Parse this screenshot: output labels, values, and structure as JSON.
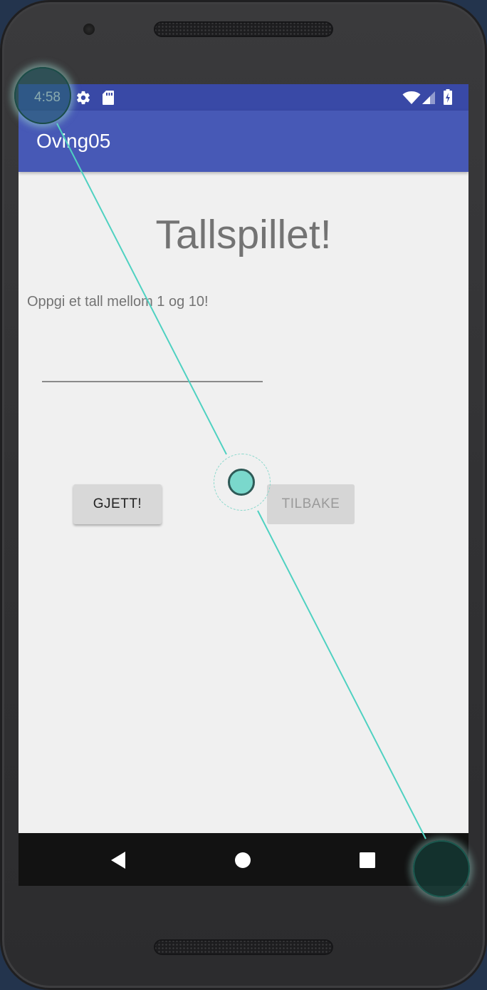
{
  "status_bar": {
    "time": "4:58",
    "icons": [
      "gear-icon",
      "sd-card-icon",
      "wifi-icon",
      "signal-icon",
      "battery-charging-icon"
    ]
  },
  "app_bar": {
    "title": "Oving05"
  },
  "main": {
    "title": "Tallspillet!",
    "prompt": "Oppgi et tall mellom 1 og 10!",
    "number_input": {
      "value": "",
      "placeholder": ""
    },
    "guess_button_label": "GJETT!",
    "back_button_label": "TILBAKE"
  },
  "nav_bar": {
    "items": [
      "back-triangle-icon",
      "home-circle-icon",
      "recents-square-icon"
    ]
  },
  "colors": {
    "status_bar": "#3949a6",
    "app_bar": "#4759b6",
    "content_bg": "#f0f0f0",
    "gesture_accent": "#4fd1c1"
  }
}
